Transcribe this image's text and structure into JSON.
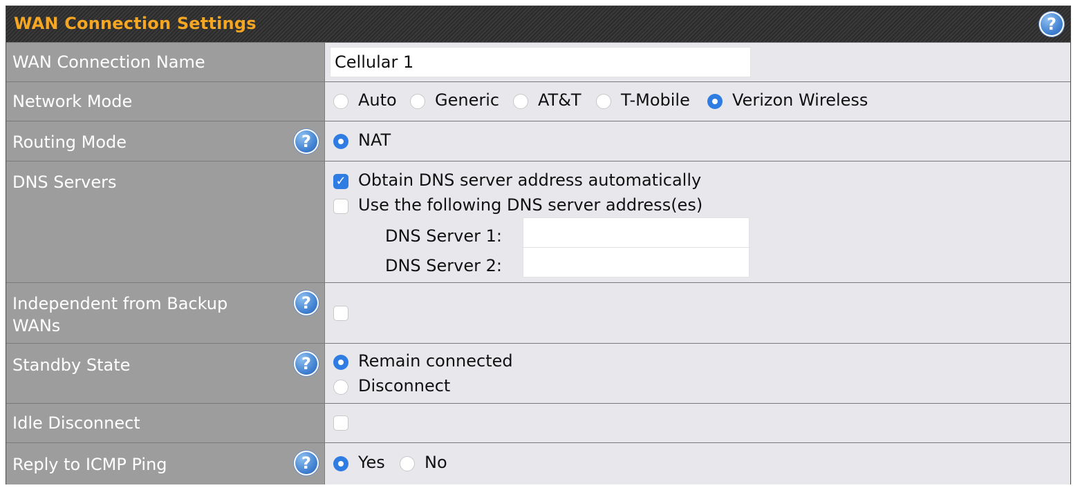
{
  "header": {
    "title": "WAN Connection Settings",
    "help_icon": "question-icon"
  },
  "rows": {
    "connection_name": {
      "label": "WAN Connection Name",
      "value": "Cellular 1"
    },
    "network_mode": {
      "label": "Network Mode",
      "options": [
        "Auto",
        "Generic",
        "AT&T",
        "T-Mobile",
        "Verizon Wireless"
      ],
      "selected": "Verizon Wireless"
    },
    "routing_mode": {
      "label": "Routing Mode",
      "options": [
        "NAT"
      ],
      "selected": "NAT"
    },
    "dns_servers": {
      "label": "DNS Servers",
      "auto_label": "Obtain DNS server address automatically",
      "auto_checked": true,
      "manual_label": "Use the following DNS server address(es)",
      "manual_checked": false,
      "server1_label": "DNS Server 1:",
      "server1_value": "",
      "server2_label": "DNS Server 2:",
      "server2_value": ""
    },
    "independent_backup": {
      "label_line1": "Independent from Backup",
      "label_line2": "WANs",
      "checked": false
    },
    "standby_state": {
      "label": "Standby State",
      "options": [
        "Remain connected",
        "Disconnect"
      ],
      "selected": "Remain connected"
    },
    "idle_disconnect": {
      "label": "Idle Disconnect",
      "checked": false
    },
    "icmp_ping": {
      "label": "Reply to ICMP Ping",
      "options": [
        "Yes",
        "No"
      ],
      "selected": "Yes"
    }
  },
  "colors": {
    "accent": "#f5a623",
    "label_bg": "#9d9d9d",
    "value_bg": "#e8e8ec",
    "radio_on": "#2f7de3"
  }
}
